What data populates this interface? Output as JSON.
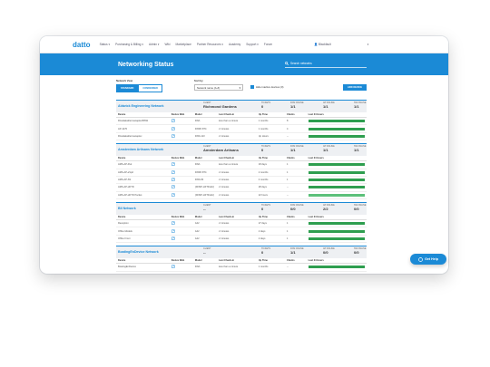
{
  "nav": {
    "logo": "datto",
    "items": [
      "Status ▾",
      "Purchasing & Billing ▾",
      "Admin ▾",
      "Wiki",
      "Marketplace",
      "Partner Resources ▾",
      "Academy",
      "Support ▾",
      "Forum"
    ],
    "user": "👤 Blackfault",
    "chevron": "▾"
  },
  "banner": {
    "title": "Networking Status",
    "search_placeholder": "Search networks",
    "search_icon": "search-icon"
  },
  "controls": {
    "view_label": "Network View",
    "view_options": [
      "STANDARD",
      "CONDENSED"
    ],
    "sort_label": "Sort by",
    "sort_value": "Network name (A-Z)",
    "hide_label": "Hide inactive devices (0)",
    "add_button": "ADD DEVICE"
  },
  "columns": [
    "Device",
    "Device Web",
    "Model",
    "Last Check-in",
    "Up Time",
    "Clients",
    "Last 24 Hours"
  ],
  "networks": [
    {
      "name": "Aldwick Engineering Network",
      "client_cap": "CLIENT",
      "client": "Richmond Gardens",
      "tickets_cap": "TICKETS",
      "tickets": "0",
      "dns_cap": "DNS ONLINE",
      "dns": "1/1",
      "ap_cap": "AP ONLINE",
      "ap": "1/1",
      "sw_cap": "SW ONLINE",
      "sw": "1/1",
      "rows": [
        {
          "device": "Rivsdaleaftermanaplex/BSW",
          "model": "DNA",
          "checkin": "less than a minute",
          "uptime": "1 months",
          "clients": "8",
          "bar": "dark"
        },
        {
          "device": "AP-1270",
          "model": "DNSP-8T4",
          "checkin": "2 minutes",
          "uptime": "1 months",
          "clients": "4",
          "bar": "dark"
        },
        {
          "device": "Rivsdaleaftermanaplex",
          "model": "DNS-123",
          "checkin": "2 minutes",
          "uptime": "Up Hours",
          "clients": "--",
          "bar": "dark"
        }
      ]
    },
    {
      "name": "Amsterdam Artisans Network",
      "client_cap": "CLIENT",
      "client": "Amsterdam Artisans",
      "tickets_cap": "TICKETS",
      "tickets": "0",
      "dns_cap": "DNS ONLINE",
      "dns": "1/1",
      "ap_cap": "AP ONLINE",
      "ap": "1/1",
      "sw_cap": "SW ONLINE",
      "sw": "1/1",
      "rows": [
        {
          "device": "AMS-AP-Dvk",
          "model": "DNA",
          "checkin": "less than a minute",
          "uptime": "18 days",
          "clients": "1",
          "bar": "dark"
        },
        {
          "device": "AMS-AP-eSpd",
          "model": "DNSP-8T4",
          "checkin": "2 minutes",
          "uptime": "2 months",
          "clients": "1",
          "bar": "dark"
        },
        {
          "device": "AMS-AP-SS",
          "model": "DNS-83",
          "checkin": "2 minutes",
          "uptime": "4 months",
          "clients": "1",
          "bar": "dark"
        },
        {
          "device": "AMS-AP-HFTD",
          "model": "(DNSP-HFTD-EU)",
          "checkin": "2 minutes",
          "uptime": "28 days",
          "clients": "--",
          "bar": "dark"
        },
        {
          "device": "AMS-AP-HFTD Pocket",
          "model": "(DNSP-HFTD-EU)",
          "checkin": "2 minutes",
          "uptime": "22 hours",
          "clients": "--",
          "bar": "light"
        }
      ]
    },
    {
      "name": "BII Network",
      "client_cap": "CLIENT",
      "client": "--",
      "tickets_cap": "TICKETS",
      "tickets": "0",
      "dns_cap": "DNS ONLINE",
      "dns": "0/0",
      "ap_cap": "AP ONLINE",
      "ap": "2/2",
      "sw_cap": "SW ONLINE",
      "sw": "0/0",
      "rows": [
        {
          "device": "Reception",
          "model": "A42",
          "checkin": "2 minutes",
          "uptime": "27 days",
          "clients": "1",
          "bar": "dark"
        },
        {
          "device": "Office Models",
          "model": "A42",
          "checkin": "2 minutes",
          "uptime": "2 days",
          "clients": "1",
          "bar": "dark"
        },
        {
          "device": "Office Front",
          "model": "A42",
          "checkin": "2 minutes",
          "uptime": "2 days",
          "clients": "1",
          "bar": "dark"
        }
      ]
    },
    {
      "name": "BoatingEnDevice Network",
      "client_cap": "CLIENT",
      "client": "--",
      "tickets_cap": "TICKETS",
      "tickets": "0",
      "dns_cap": "DNS ONLINE",
      "dns": "1/1",
      "ap_cap": "AP ONLINE",
      "ap": "0/0",
      "sw_cap": "SW ONLINE",
      "sw": "0/0",
      "rows": [
        {
          "device": "BoatingEnDevice",
          "model": "DNA",
          "checkin": "less than a minute",
          "uptime": "1 months",
          "clients": "--",
          "bar": "dark"
        }
      ]
    }
  ],
  "help_button": "Get Help",
  "colors": {
    "brand": "#1b8ad6",
    "bar_dark": "#2e9e4f",
    "bar_light": "#5cc07a"
  }
}
